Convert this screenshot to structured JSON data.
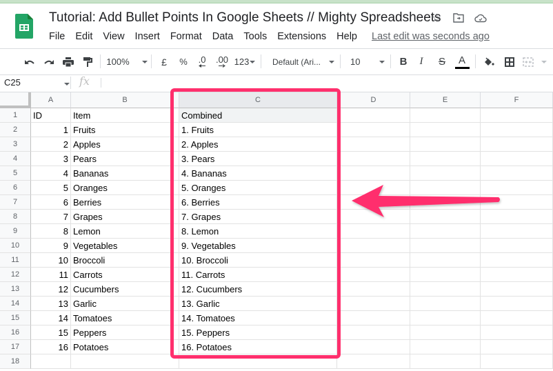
{
  "app": {
    "title": "Tutorial: Add Bullet Points In Google Sheets // Mighty Spreadsheets",
    "icons": [
      "star-icon",
      "move-to-folder-icon",
      "cloud-saved-icon"
    ],
    "brand_color": "#23a566"
  },
  "menu": {
    "items": [
      "File",
      "Edit",
      "View",
      "Insert",
      "Format",
      "Data",
      "Tools",
      "Extensions",
      "Help"
    ],
    "last_edit": "Last edit was seconds ago"
  },
  "toolbar": {
    "zoom": "100%",
    "currency": "£",
    "percent": "%",
    "decrease_decimal": ".0",
    "increase_decimal": ".00",
    "more_formats": "123",
    "font": "Default (Ari...",
    "font_size": "10",
    "bold": "B",
    "italic": "I",
    "strikethrough": "S",
    "text_color": "A"
  },
  "formula_bar": {
    "name_box": "C25",
    "fx": "fx",
    "value": ""
  },
  "sheet": {
    "columns": [
      "A",
      "B",
      "C",
      "D",
      "E",
      "F"
    ],
    "selected_column": "C",
    "row_numbers": [
      "1",
      "2",
      "3",
      "4",
      "5",
      "6",
      "7",
      "8",
      "9",
      "10",
      "11",
      "12",
      "13",
      "14",
      "15",
      "16",
      "17",
      "18"
    ],
    "headers": {
      "A": "ID",
      "B": "Item",
      "C": "Combined"
    },
    "rows": [
      {
        "id": "1",
        "item": "Fruits",
        "combined": "1. Fruits"
      },
      {
        "id": "2",
        "item": "Apples",
        "combined": "2. Apples"
      },
      {
        "id": "3",
        "item": "Pears",
        "combined": "3. Pears"
      },
      {
        "id": "4",
        "item": "Bananas",
        "combined": "4. Bananas"
      },
      {
        "id": "5",
        "item": "Oranges",
        "combined": "5. Oranges"
      },
      {
        "id": "6",
        "item": "Berries",
        "combined": "6. Berries"
      },
      {
        "id": "7",
        "item": "Grapes",
        "combined": "7. Grapes"
      },
      {
        "id": "8",
        "item": "Lemon",
        "combined": "8. Lemon"
      },
      {
        "id": "9",
        "item": "Vegetables",
        "combined": "9. Vegetables"
      },
      {
        "id": "10",
        "item": "Broccoli",
        "combined": "10. Broccoli"
      },
      {
        "id": "11",
        "item": "Carrots",
        "combined": "11. Carrots"
      },
      {
        "id": "12",
        "item": "Cucumbers",
        "combined": "12. Cucumbers"
      },
      {
        "id": "13",
        "item": "Garlic",
        "combined": "13. Garlic"
      },
      {
        "id": "14",
        "item": "Tomatoes",
        "combined": "14. Tomatoes"
      },
      {
        "id": "15",
        "item": "Peppers",
        "combined": "15. Peppers"
      },
      {
        "id": "16",
        "item": "Potatoes",
        "combined": "16. Potatoes"
      }
    ]
  },
  "annotation": {
    "highlight_color": "#ff2f6d",
    "highlight_target": "Column C (Combined)",
    "arrow_direction": "left"
  }
}
